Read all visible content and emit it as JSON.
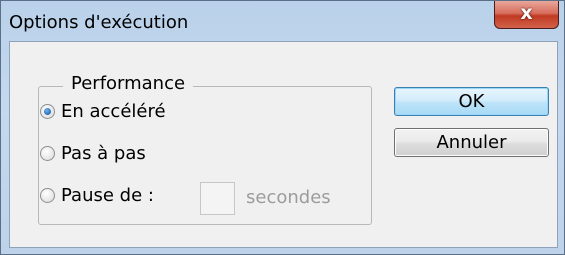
{
  "window": {
    "title": "Options d'exécution",
    "close_glyph": "x"
  },
  "performance_group": {
    "legend": "Performance",
    "options": [
      {
        "label": "En accéléré",
        "selected": true
      },
      {
        "label": "Pas à pas",
        "selected": false
      },
      {
        "label": "Pause de :",
        "selected": false
      }
    ],
    "pause_seconds_value": "",
    "seconds_label": "secondes"
  },
  "buttons": {
    "ok_label": "OK",
    "cancel_label": "Annuler"
  }
}
